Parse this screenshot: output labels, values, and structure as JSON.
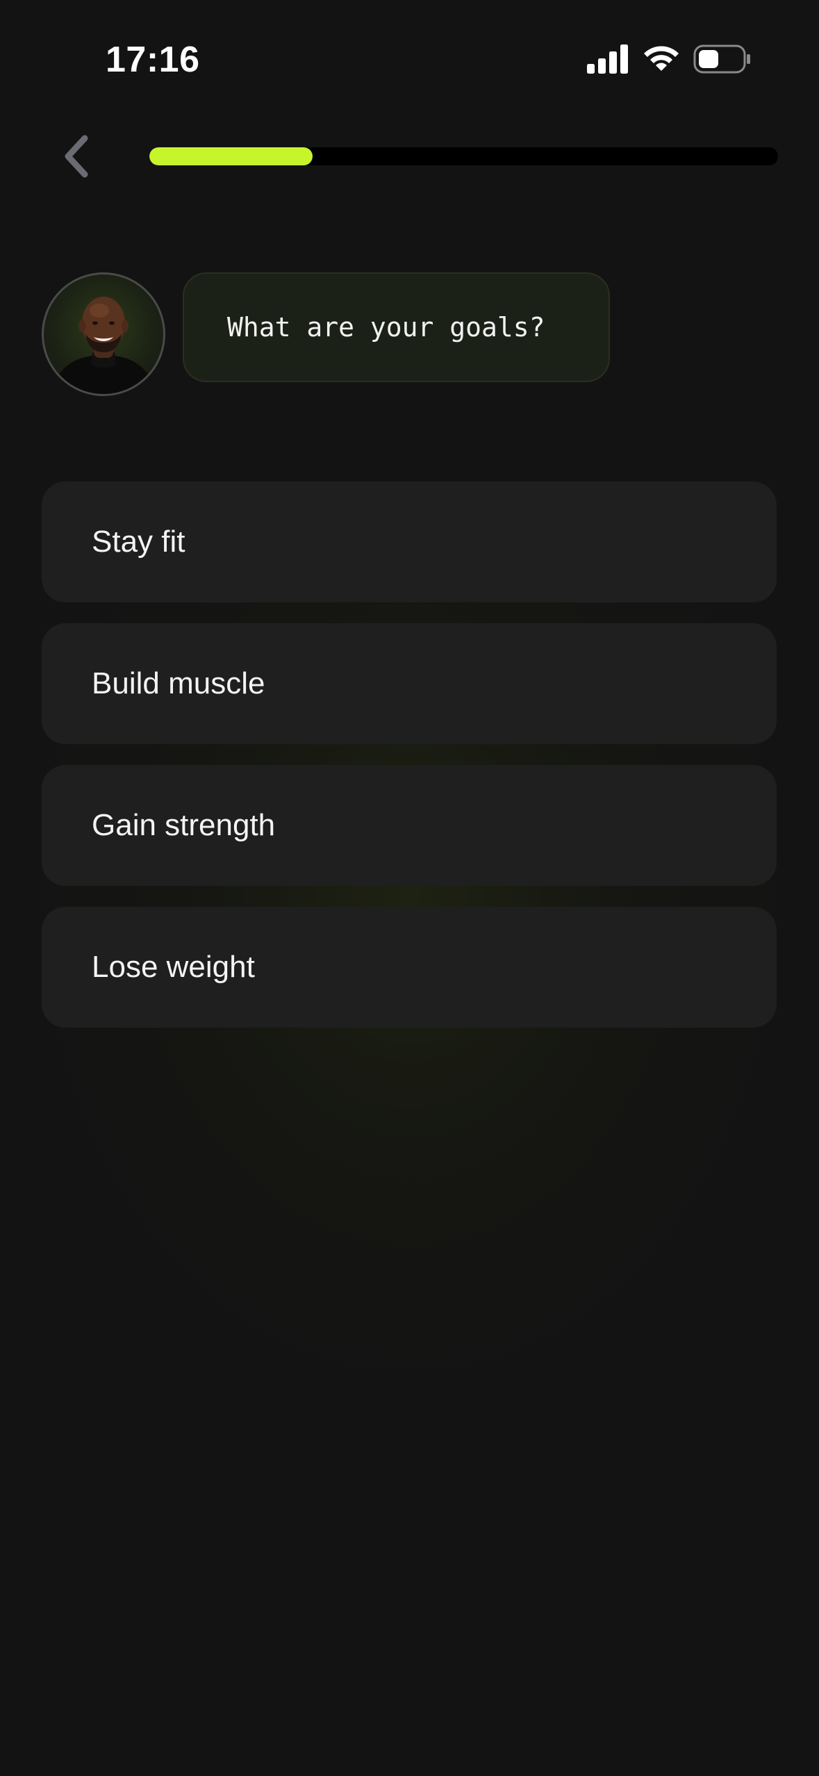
{
  "status_bar": {
    "time": "17:16",
    "icons": [
      "signal-icon",
      "wifi-icon",
      "battery-icon"
    ]
  },
  "header": {
    "back_icon": "chevron-left-icon",
    "progress": 0.26,
    "progress_color": "#c6f52c"
  },
  "coach": {
    "avatar": "coach-avatar",
    "question": "What are your goals?"
  },
  "options": [
    {
      "label": "Stay fit"
    },
    {
      "label": "Build muscle"
    },
    {
      "label": "Gain strength"
    },
    {
      "label": "Lose weight"
    }
  ]
}
